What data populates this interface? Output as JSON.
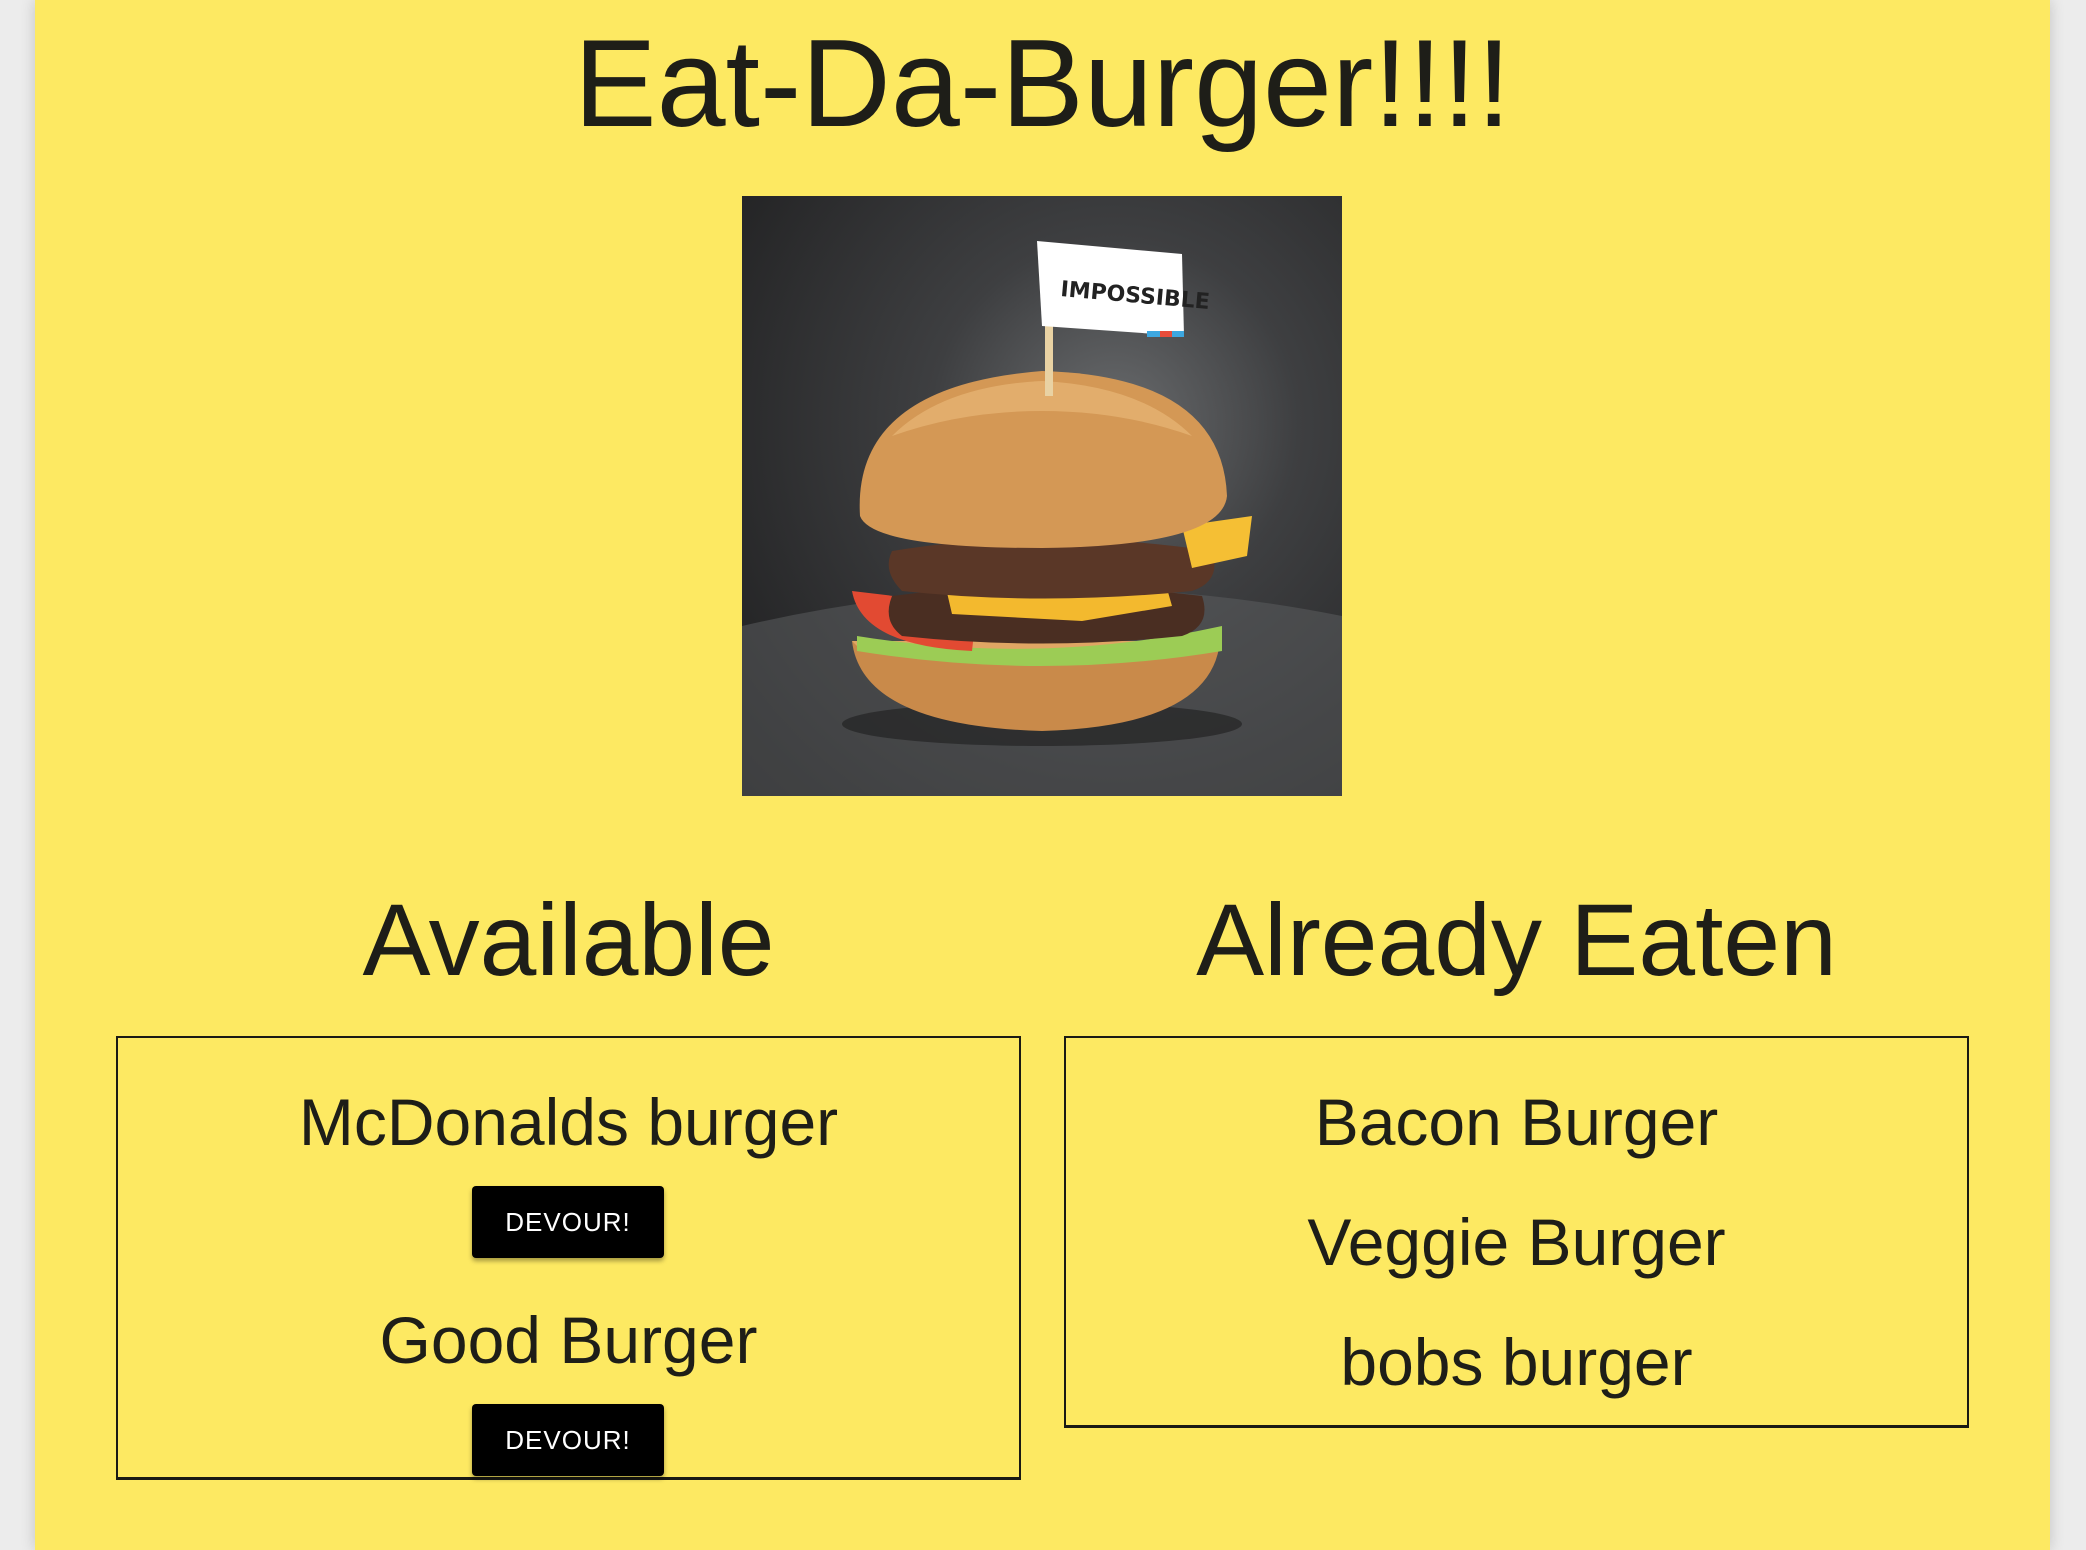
{
  "header": {
    "title": "Eat-Da-Burger!!!!"
  },
  "hero": {
    "flag_text": "IMPOSSIBLE"
  },
  "available": {
    "heading": "Available",
    "items": [
      {
        "name": "McDonalds burger",
        "button_label": "DEVOUR!"
      },
      {
        "name": "Good Burger",
        "button_label": "DEVOUR!"
      }
    ]
  },
  "eaten": {
    "heading": "Already Eaten",
    "items": [
      {
        "name": "Bacon Burger"
      },
      {
        "name": "Veggie Burger"
      },
      {
        "name": "bobs burger"
      }
    ]
  },
  "colors": {
    "page_background": "#fde962",
    "text": "#1e1e18",
    "button_background": "#000000",
    "button_text": "#ffffff"
  }
}
